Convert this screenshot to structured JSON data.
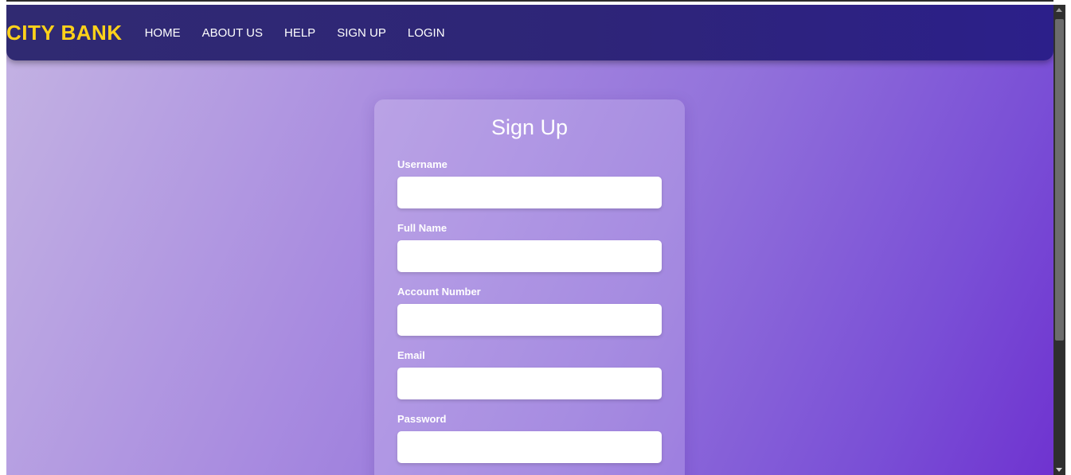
{
  "navbar": {
    "brand": "CITY BANK",
    "links": [
      "HOME",
      "ABOUT US",
      "HELP",
      "SIGN UP",
      "LOGIN"
    ]
  },
  "form": {
    "title": "Sign Up",
    "fields": [
      {
        "label": "Username",
        "value": ""
      },
      {
        "label": "Full Name",
        "value": ""
      },
      {
        "label": "Account Number",
        "value": ""
      },
      {
        "label": "Email",
        "value": ""
      },
      {
        "label": "Password",
        "value": ""
      }
    ]
  },
  "colors": {
    "brand": "#ffd21a",
    "navbar": "#2e2578",
    "background_start": "#c4b3e3",
    "background_end": "#6f33d0"
  },
  "scrollbar": {
    "position": 0
  }
}
